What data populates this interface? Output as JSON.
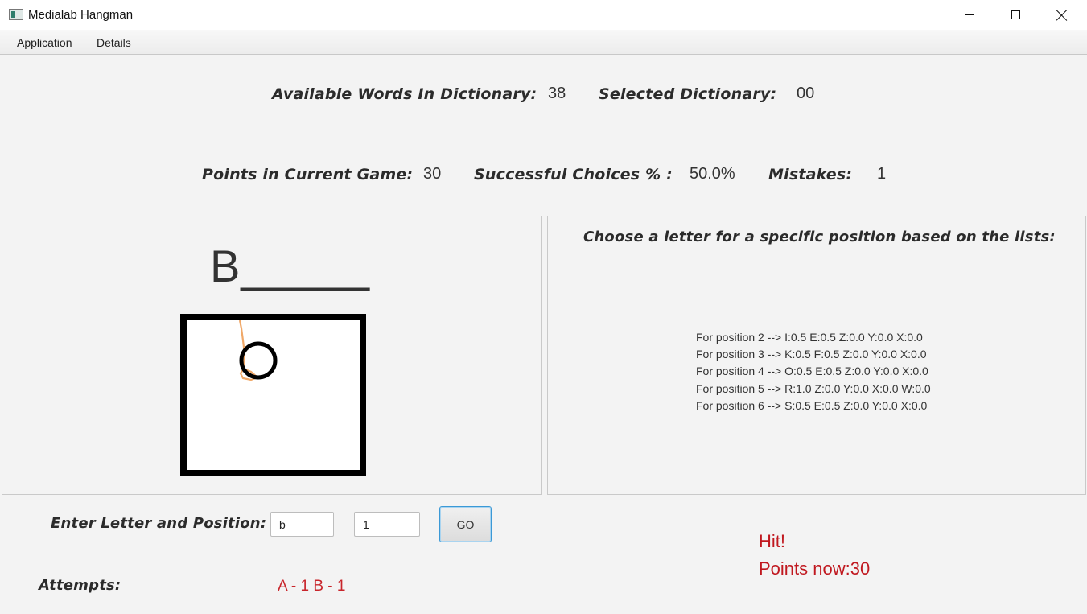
{
  "window": {
    "title": "Medialab Hangman"
  },
  "menu": {
    "items": [
      {
        "label": "Application"
      },
      {
        "label": "Details"
      }
    ]
  },
  "stats": {
    "available_words_label": "Available Words In Dictionary:",
    "available_words_value": "38",
    "selected_dictionary_label": "Selected Dictionary:",
    "selected_dictionary_value": "00",
    "points_label": "Points in Current Game:",
    "points_value": "30",
    "success_label": "Successful Choices % :",
    "success_value": "50.0%",
    "mistakes_label": "Mistakes:",
    "mistakes_value": "1"
  },
  "game": {
    "word_display": "B_____"
  },
  "suggestions": {
    "title": "Choose a letter for a specific position based on the lists:",
    "lines": [
      "For position 2 --> I:0.5 E:0.5 Z:0.0 Y:0.0 X:0.0",
      "For position 3 --> K:0.5 F:0.5 Z:0.0 Y:0.0 X:0.0",
      "For position 4 --> O:0.5 E:0.5 Z:0.0 Y:0.0 X:0.0",
      "For position 5 --> R:1.0 Z:0.0 Y:0.0 X:0.0 W:0.0",
      "For position 6 --> S:0.5 E:0.5 Z:0.0 Y:0.0 X:0.0"
    ]
  },
  "input": {
    "label": "Enter Letter and Position:",
    "letter_value": "b",
    "position_value": "1",
    "go_label": "GO"
  },
  "attempts": {
    "label": "Attempts:",
    "value": "A - 1  B - 1"
  },
  "result": {
    "message": "Hit!",
    "points": "Points now:30"
  },
  "colors": {
    "accent_red": "#c0181f",
    "go_border": "#3b99d6"
  }
}
